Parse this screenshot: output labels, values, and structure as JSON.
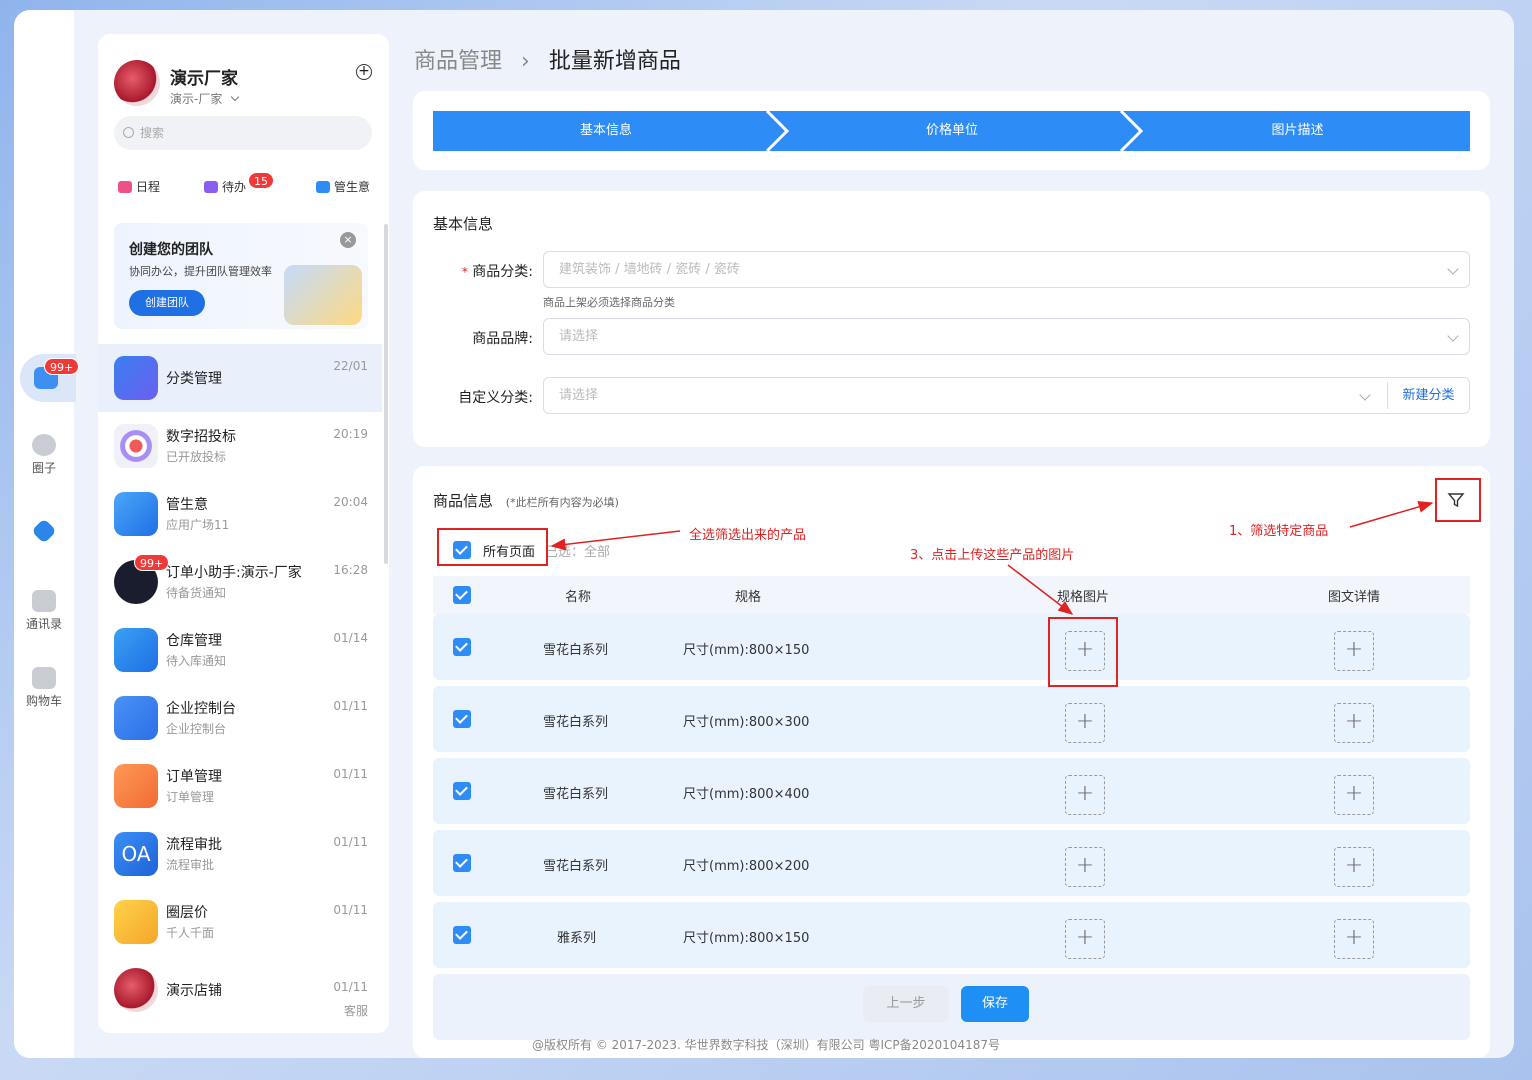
{
  "rail": {
    "chat_badge": "99+",
    "items": [
      {
        "label": "圈子"
      },
      {
        "label": "通讯录"
      },
      {
        "label": "购物车"
      }
    ]
  },
  "panel": {
    "user_name": "演示厂家",
    "user_sub": "演示-厂家",
    "search_placeholder": "搜索",
    "quick": {
      "schedule": "日程",
      "todo": "待办",
      "todo_badge": "15",
      "biz": "管生意"
    },
    "banner": {
      "title": "创建您的团队",
      "desc": "协同办公，提升团队管理效率",
      "button": "创建团队"
    },
    "items": [
      {
        "title": "分类管理",
        "sub": "",
        "time": "22/01"
      },
      {
        "title": "数字招投标",
        "sub": "已开放投标",
        "time": "20:19"
      },
      {
        "title": "管生意",
        "sub": "应用广场11",
        "time": "20:04"
      },
      {
        "title": "订单小助手:演示-厂家",
        "sub": "待备货通知",
        "time": "16:28",
        "badge": "99+"
      },
      {
        "title": "仓库管理",
        "sub": "待入库通知",
        "time": "01/14"
      },
      {
        "title": "企业控制台",
        "sub": "企业控制台",
        "time": "01/11"
      },
      {
        "title": "订单管理",
        "sub": "订单管理",
        "time": "01/11"
      },
      {
        "title": "流程审批",
        "sub": "流程审批",
        "time": "01/11"
      },
      {
        "title": "圈层价",
        "sub": "千人千面",
        "time": "01/11"
      },
      {
        "title": "演示店铺",
        "sub": "",
        "time": "01/11",
        "extra": "客服"
      }
    ]
  },
  "breadcrumb": {
    "parent": "商品管理",
    "sep": "›",
    "current": "批量新增商品"
  },
  "steps": [
    "基本信息",
    "价格单位",
    "图片描述"
  ],
  "basic": {
    "title": "基本信息",
    "category_label": "商品分类:",
    "category_value": "建筑装饰 / 墙地砖 / 瓷砖 / 瓷砖",
    "category_hint": "商品上架必须选择商品分类",
    "brand_label": "商品品牌:",
    "brand_placeholder": "请选择",
    "custom_label": "自定义分类:",
    "custom_placeholder": "请选择",
    "new_category": "新建分类"
  },
  "goods": {
    "title": "商品信息",
    "note": "(*此栏所有内容为必填)",
    "all_pages": "所有页面",
    "selected": "已选：全部",
    "headers": {
      "name": "名称",
      "spec": "规格",
      "spec_img": "规格图片",
      "detail": "图文详情"
    },
    "rows": [
      {
        "name": "雪花白系列",
        "spec": "尺寸(mm):800×150"
      },
      {
        "name": "雪花白系列",
        "spec": "尺寸(mm):800×300"
      },
      {
        "name": "雪花白系列",
        "spec": "尺寸(mm):800×400"
      },
      {
        "name": "雪花白系列",
        "spec": "尺寸(mm):800×200"
      },
      {
        "name": "雅系列",
        "spec": "尺寸(mm):800×150"
      }
    ],
    "prev": "上一步",
    "save": "保存"
  },
  "annotations": {
    "a1": "1、筛选特定商品",
    "a2": "全选筛选出来的产品",
    "a3": "3、点击上传这些产品的图片"
  },
  "footer": "@版权所有 © 2017-2023. 华世界数字科技（深圳）有限公司 粤ICP备2020104187号",
  "colors": {
    "primary": "#2e8cf7",
    "annotation": "#e02222"
  }
}
